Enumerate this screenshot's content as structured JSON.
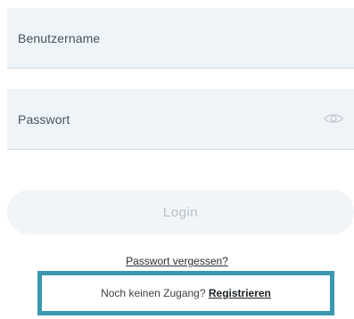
{
  "form": {
    "username": {
      "placeholder": "Benutzername",
      "value": ""
    },
    "password": {
      "placeholder": "Passwort",
      "value": "",
      "toggle_icon": "eye-icon"
    },
    "login_label": "Login",
    "forgot_password_label": "Passwort vergessen?",
    "signup": {
      "prompt": "Noch keinen Zugang?",
      "link_label": "Registrieren"
    }
  },
  "colors": {
    "field_background": "#eff4f8",
    "button_background": "#f1f5f8",
    "button_text_disabled": "#b8c1c8",
    "highlight_border": "#3a98b0"
  }
}
